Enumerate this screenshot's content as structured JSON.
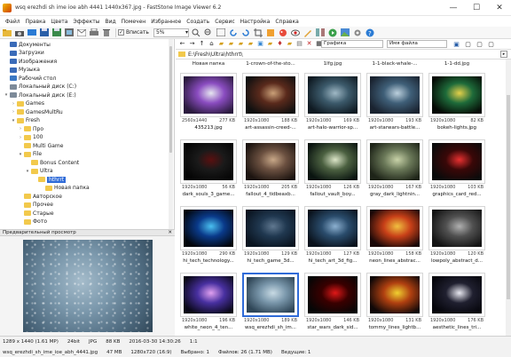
{
  "window": {
    "title": "wsq erezhdi sh ime ioe abh 4441 1440x367.jpg - FastStone Image Viewer 6.2",
    "min": "—",
    "max": "☐",
    "close": "✕"
  },
  "menu": [
    "Файл",
    "Правка",
    "Цвета",
    "Эффекты",
    "Вид",
    "Помечен",
    "Избранное",
    "Создать",
    "Сервис",
    "Настройка",
    "Справка"
  ],
  "toolbar": {
    "fit_label": "Вписать",
    "zoom_value": "5%",
    "zoom_arrow": "▾"
  },
  "nav": {
    "filter_value": "Графика",
    "sort_value": "Имя файла"
  },
  "path": "E:\\Fresh\\Ultra\\hthrrt\\",
  "tree": [
    {
      "label": "Документы",
      "level": 1,
      "icon": "dark",
      "exp": ""
    },
    {
      "label": "Загрузки",
      "level": 1,
      "icon": "dark",
      "exp": ""
    },
    {
      "label": "Изображения",
      "level": 1,
      "icon": "dark",
      "exp": ""
    },
    {
      "label": "Музыка",
      "level": 1,
      "icon": "dark",
      "exp": ""
    },
    {
      "label": "Рабочий стол",
      "level": 1,
      "icon": "blue",
      "exp": ""
    },
    {
      "label": "Локальный диск (C:)",
      "level": 1,
      "icon": "drive",
      "exp": ""
    },
    {
      "label": "Локальный диск (E:)",
      "level": 1,
      "icon": "drive",
      "exp": "▾"
    },
    {
      "label": "Games",
      "level": 2,
      "icon": "",
      "exp": "›"
    },
    {
      "label": "GamesMultRu",
      "level": 2,
      "icon": "",
      "exp": "›"
    },
    {
      "label": "Fresh",
      "level": 2,
      "icon": "",
      "exp": "▾"
    },
    {
      "label": "Про",
      "level": 3,
      "icon": "",
      "exp": "›"
    },
    {
      "label": "100",
      "level": 3,
      "icon": "",
      "exp": "›"
    },
    {
      "label": "Multi Game",
      "level": 3,
      "icon": "",
      "exp": ""
    },
    {
      "label": "File",
      "level": 3,
      "icon": "",
      "exp": "▾"
    },
    {
      "label": "Bonus Content",
      "level": 4,
      "icon": "",
      "exp": ""
    },
    {
      "label": "Ultra",
      "level": 4,
      "icon": "",
      "exp": "▾"
    },
    {
      "label": "hthrrt",
      "level": 5,
      "icon": "",
      "exp": "",
      "selected": true
    },
    {
      "label": "Новая папка",
      "level": 6,
      "icon": "",
      "exp": ""
    },
    {
      "label": "Авторское",
      "level": 3,
      "icon": "",
      "exp": ""
    },
    {
      "label": "Прочее",
      "level": 3,
      "icon": "",
      "exp": ""
    },
    {
      "label": "Старые",
      "level": 3,
      "icon": "",
      "exp": ""
    },
    {
      "label": "Фото",
      "level": 3,
      "icon": "",
      "exp": ""
    }
  ],
  "preview": {
    "header": "Предварительный просмотр",
    "close": "✕"
  },
  "top_partial_names": [
    "Новая папка",
    "1-crown-of-the-sto...",
    "1lfg.jpg",
    "1-1-black-whale-...",
    "1-1-dd.jpg"
  ],
  "thumbnails": [
    {
      "dim": "2560x1440",
      "size": "277 KB",
      "name": "435213.jpg",
      "colors": [
        "#2b1b3e",
        "#8a4cc0",
        "#e6e6f0"
      ]
    },
    {
      "dim": "1920x1080",
      "size": "188 KB",
      "name": "art-assassin-creed-...",
      "colors": [
        "#101010",
        "#5a2a1c",
        "#caa078"
      ]
    },
    {
      "dim": "1920x1080",
      "size": "169 KB",
      "name": "art-halo-warrior-sp...",
      "colors": [
        "#0f1a22",
        "#3c5a6b",
        "#9fb8c5"
      ]
    },
    {
      "dim": "1920x1080",
      "size": "193 KB",
      "name": "art-starwars-battle...",
      "colors": [
        "#1a2330",
        "#3f5f78",
        "#bcd0dd"
      ]
    },
    {
      "dim": "1920x1080",
      "size": "82 KB",
      "name": "bokeh-lights.jpg",
      "colors": [
        "#050a05",
        "#1e6b3a",
        "#e3d04a"
      ]
    },
    {
      "dim": "1920x1080",
      "size": "56 KB",
      "name": "dark_souls_3_game...",
      "colors": [
        "#050505",
        "#1a1a1a",
        "#5a1010"
      ]
    },
    {
      "dim": "1920x1080",
      "size": "205 KB",
      "name": "fallout_4_tidbeaxb...",
      "colors": [
        "#1c1410",
        "#6b5040",
        "#c8a888"
      ]
    },
    {
      "dim": "1920x1080",
      "size": "126 KB",
      "name": "fallout_vault_boy...",
      "colors": [
        "#0a1410",
        "#4b6040",
        "#dce6c8"
      ]
    },
    {
      "dim": "1920x1080",
      "size": "167 KB",
      "name": "gray_dark_lightnin...",
      "colors": [
        "#1e2418",
        "#6a7858",
        "#c8d2a8"
      ]
    },
    {
      "dim": "1920x1080",
      "size": "103 KB",
      "name": "graphics_card_red...",
      "colors": [
        "#0a0a0a",
        "#3a0808",
        "#e83030"
      ]
    },
    {
      "dim": "1920x1080",
      "size": "290 KB",
      "name": "hi_tech_technology...",
      "colors": [
        "#02060c",
        "#0a3a8a",
        "#4ac0f0"
      ]
    },
    {
      "dim": "1920x1080",
      "size": "129 KB",
      "name": "hi_tech_game_3d...",
      "colors": [
        "#0a1420",
        "#203850",
        "#607890"
      ]
    },
    {
      "dim": "1920x1080",
      "size": "127 KB",
      "name": "hi_tech_art_3d_fig...",
      "colors": [
        "#0a121c",
        "#2a4c6c",
        "#8cb0d0"
      ]
    },
    {
      "dim": "1920x1080",
      "size": "158 KB",
      "name": "neon_lines_abstrac...",
      "colors": [
        "#1a0808",
        "#c84018",
        "#f0c040"
      ]
    },
    {
      "dim": "1920x1080",
      "size": "120 KB",
      "name": "lowpoly_abstract_d...",
      "colors": [
        "#141414",
        "#505050",
        "#b0b0b0"
      ]
    },
    {
      "dim": "1920x1080",
      "size": "196 KB",
      "name": "white_neon_4_ten...",
      "colors": [
        "#0a0818",
        "#4830a0",
        "#e0a0f0"
      ]
    },
    {
      "dim": "1920x1080",
      "size": "189 KB",
      "name": "wsq_erezhdi_sh_im...",
      "colors": [
        "#2f4657",
        "#7b98ac",
        "#c8dae4"
      ],
      "selected": true
    },
    {
      "dim": "1920x1080",
      "size": "146 KB",
      "name": "star_wars_dark_sid...",
      "colors": [
        "#060606",
        "#3a0000",
        "#e01818"
      ]
    },
    {
      "dim": "1920x1080",
      "size": "131 KB",
      "name": "tommy_lines_lightb...",
      "colors": [
        "#100808",
        "#b04010",
        "#f0d030"
      ]
    },
    {
      "dim": "1920x1080",
      "size": "176 KB",
      "name": "aesthetic_lines_tri...",
      "colors": [
        "#06060c",
        "#202030",
        "#e8e8f0"
      ]
    }
  ],
  "status": {
    "line1": [
      "1289 x 1440 (1.61 MP)",
      "24bit",
      "JPG",
      "88 KB",
      "2016-03-30 14:30:26",
      "1:1"
    ],
    "line2": [
      "wsq_erezhdi_sh_ime_ioe_abh_4441.jpg",
      "47 MB",
      "1280x720 (16:9)",
      "Выбрано: 1",
      "Файлов: 26 (1.71 MB)",
      "Ведущие: 1"
    ]
  }
}
